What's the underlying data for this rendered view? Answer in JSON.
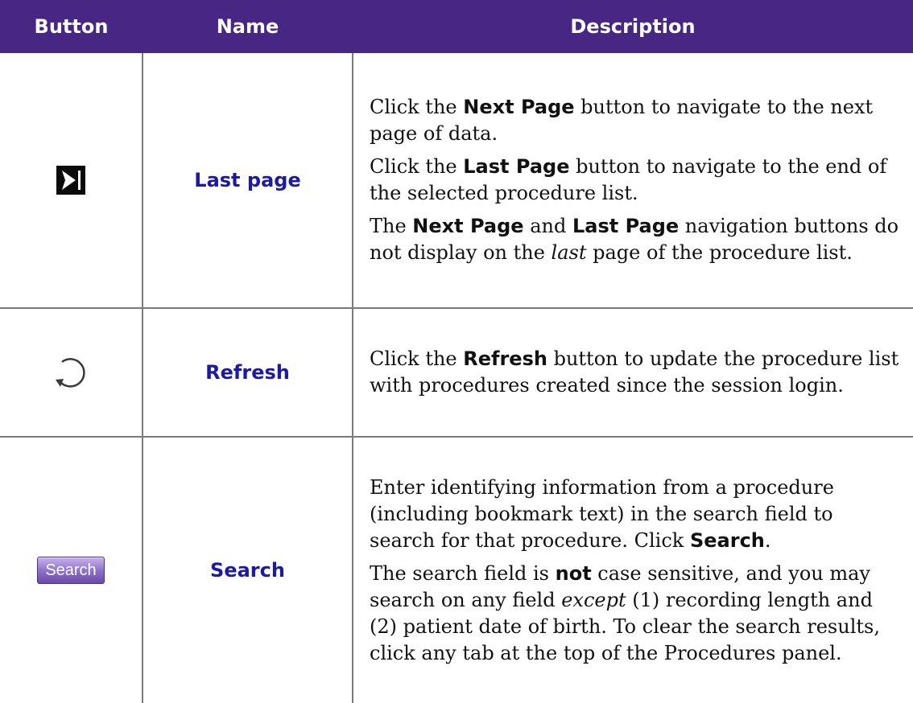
{
  "headers": {
    "button": "Button",
    "name": "Name",
    "description": "Description"
  },
  "rows": [
    {
      "icon": "last-page-icon",
      "name": "Last page",
      "desc": [
        [
          "Click the ",
          "Next Page",
          " button to navigate to the next page of data."
        ],
        [
          "Click the ",
          "Last Page",
          " button to navigate to the end of the selected procedure list."
        ],
        [
          "The ",
          "Next Page",
          " and ",
          "Last Page",
          " navigation buttons do not display on the ",
          "last",
          " page of the procedure list."
        ]
      ]
    },
    {
      "icon": "refresh-icon",
      "name": "Refresh",
      "desc": [
        [
          "Click the ",
          "Refresh",
          " button to update the procedure list with procedures created since the session login."
        ]
      ]
    },
    {
      "icon": "search-button",
      "button_label": "Search",
      "name": "Search",
      "desc": [
        [
          "Enter identifying information from a procedure (including bookmark text) in the search field to search for that procedure.  Click ",
          "Search",
          "."
        ],
        [
          "The search field is ",
          "not",
          " case sensitive, and you may search on any field ",
          "except",
          " (1) recording length and (2) patient date of birth.  To clear the search results, click any tab at the top of the Procedures panel."
        ]
      ]
    }
  ],
  "colors": {
    "header_bg": "#482683",
    "name_text": "#1a1aa6",
    "border": "#7a7a7a"
  }
}
